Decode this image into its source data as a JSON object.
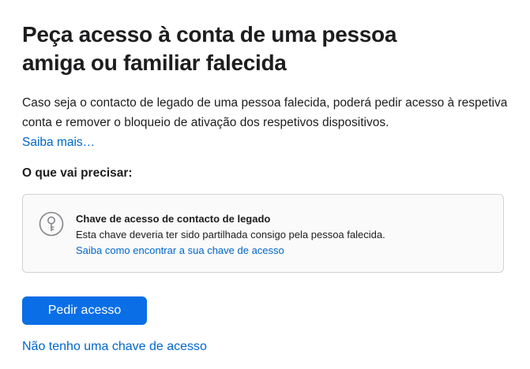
{
  "header": {
    "title": "Peça acesso à conta de uma pessoa amiga ou familiar falecida"
  },
  "intro": {
    "text": "Caso seja o contacto de legado de uma pessoa falecida, poderá pedir acesso à respetiva conta e remover o bloqueio de ativação dos respetivos dispositivos.",
    "learn_more": "Saiba mais…"
  },
  "requirements": {
    "heading": "O que vai precisar:",
    "card": {
      "icon": "key-icon",
      "title": "Chave de acesso de contacto de legado",
      "description": "Esta chave deveria ter sido partilhada consigo pela pessoa falecida.",
      "link": "Saiba como encontrar a sua chave de acesso"
    }
  },
  "actions": {
    "primary_label": "Pedir acesso",
    "secondary_label": "Não tenho uma chave de acesso"
  },
  "colors": {
    "accent": "#0a6ee6",
    "link": "#0066cc",
    "text": "#1d1d1f",
    "card_border": "#d2d2d7",
    "card_background": "#fafafa",
    "icon": "#86868b"
  }
}
